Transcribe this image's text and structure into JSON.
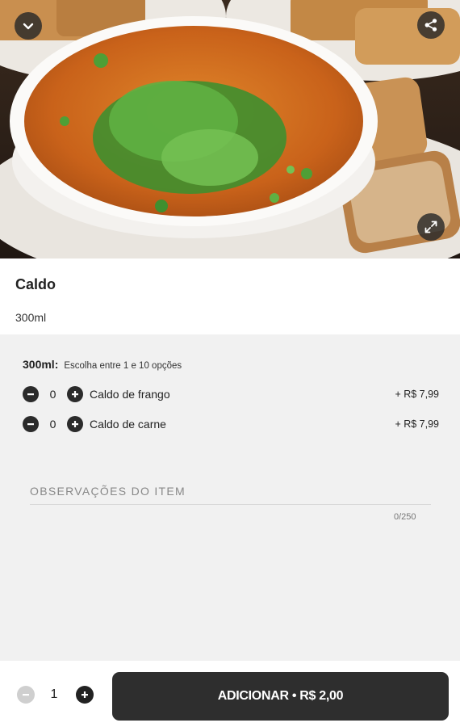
{
  "hero": {
    "image_subject": "bowl of orange soup with chopped green onions and toasted bread",
    "buttons": {
      "collapse_icon": "chevron-down-icon",
      "share_icon": "share-icon",
      "expand_icon": "expand-icon"
    }
  },
  "item": {
    "title": "Caldo",
    "description": "300ml"
  },
  "group": {
    "name": "300ml:",
    "hint": "Escolha entre 1 e 10 opções",
    "options": [
      {
        "label": "Caldo de frango",
        "quantity": "0",
        "price": "+ R$ 7,99"
      },
      {
        "label": "Caldo de carne",
        "quantity": "0",
        "price": "+ R$ 7,99"
      }
    ]
  },
  "notes": {
    "label": "OBSERVAÇÕES DO ITEM",
    "counter": "0/250"
  },
  "footer": {
    "quantity": "1",
    "add_label": "ADICIONAR • R$ 2,00"
  },
  "colors": {
    "dark": "#2e2e2e",
    "background": "#f1f1f1",
    "muted": "#888888",
    "disabled": "#cfcfcf"
  }
}
